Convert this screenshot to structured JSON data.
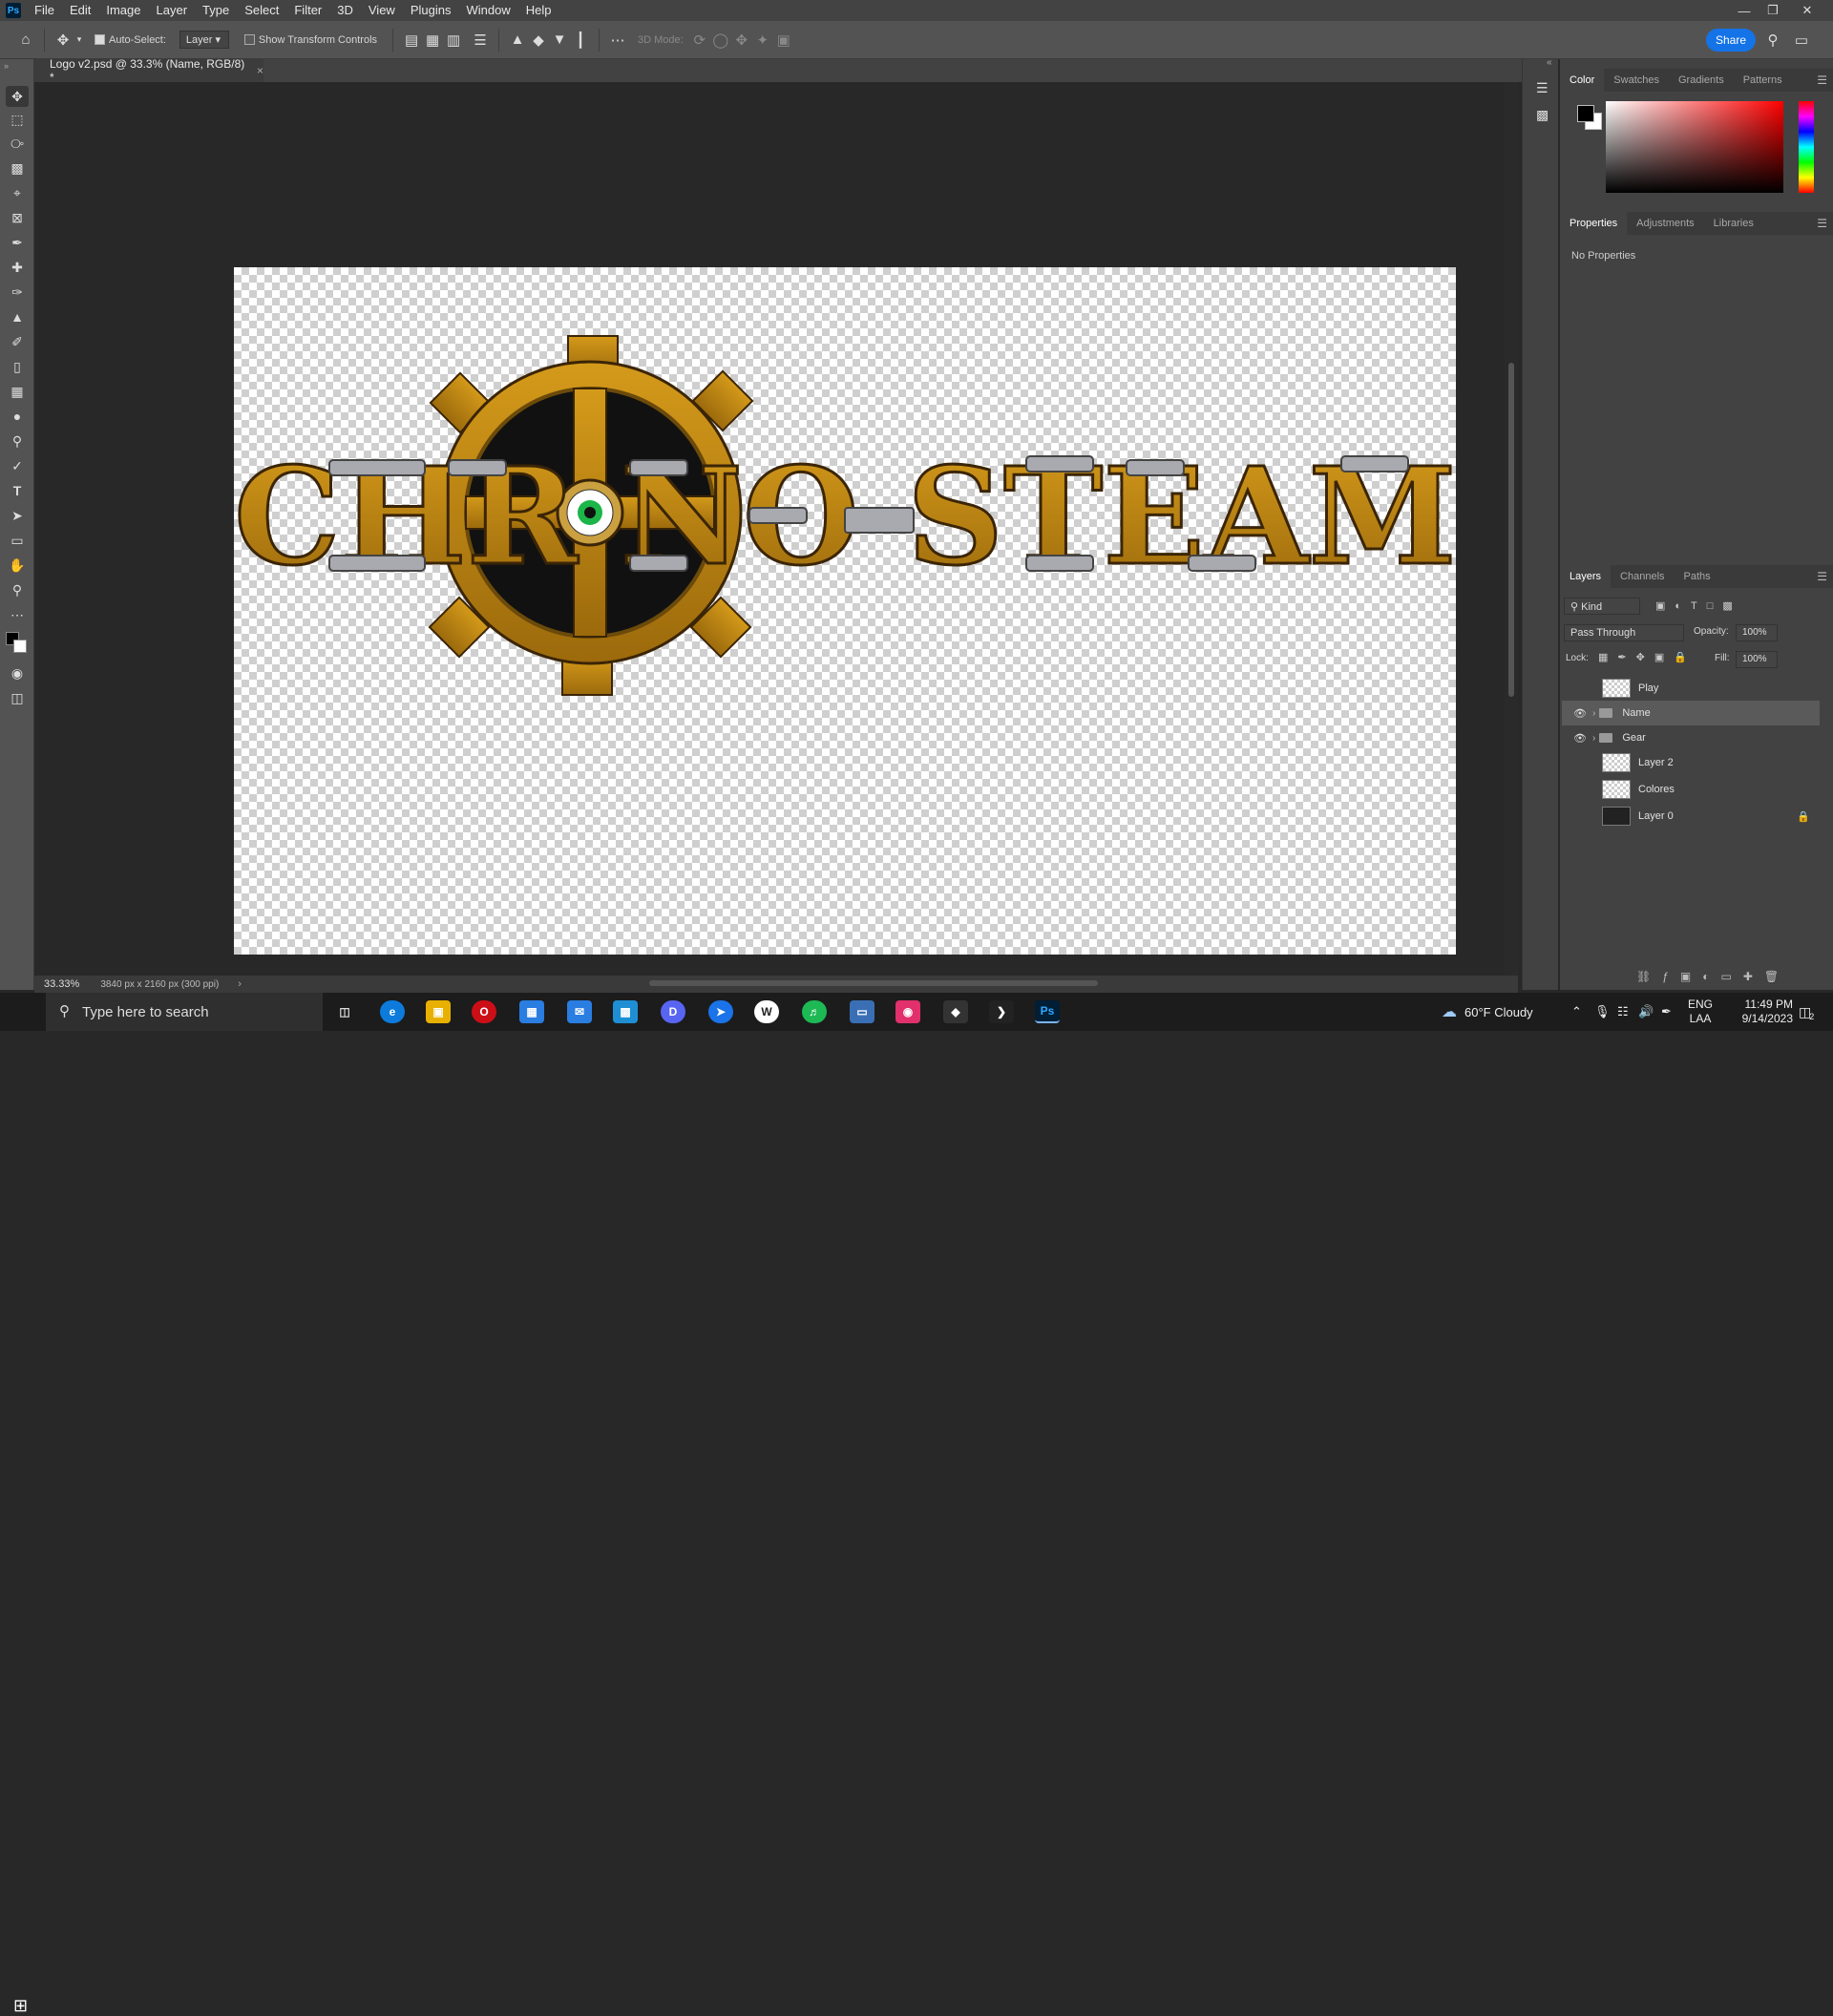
{
  "menubar": {
    "items": [
      "File",
      "Edit",
      "Image",
      "Layer",
      "Type",
      "Select",
      "Filter",
      "3D",
      "View",
      "Plugins",
      "Window",
      "Help"
    ]
  },
  "options_bar": {
    "auto_select_label": "Auto-Select:",
    "auto_select_checked": true,
    "auto_select_target": "Layer",
    "show_transform_label": "Show Transform Controls",
    "mode_3d_label": "3D Mode:",
    "share_label": "Share"
  },
  "document": {
    "tab_title": "Logo v2.psd @ 33.3% (Name, RGB/8) *",
    "artwork": {
      "logo_text_left": "CHR",
      "logo_text_mid": "NO",
      "logo_text_right": "STEAM",
      "brass_color": "#b8860b",
      "dark_color": "#3b2507"
    }
  },
  "status": {
    "zoom": "33.33%",
    "doc_info": "3840 px x 2160 px (300 ppi)"
  },
  "color_panel": {
    "tabs": [
      "Color",
      "Swatches",
      "Gradients",
      "Patterns"
    ],
    "active_tab": "Color",
    "foreground": "#000000",
    "background": "#ffffff",
    "hue": "#ff0000"
  },
  "properties_panel": {
    "tabs": [
      "Properties",
      "Adjustments",
      "Libraries"
    ],
    "active_tab": "Properties",
    "empty_text": "No Properties"
  },
  "layers_panel": {
    "tabs": [
      "Layers",
      "Channels",
      "Paths"
    ],
    "active_tab": "Layers",
    "filter_kind": "Kind",
    "blend_mode": "Pass Through",
    "opacity_label": "Opacity:",
    "opacity": "100%",
    "lock_label": "Lock:",
    "fill_label": "Fill:",
    "fill": "100%",
    "layers": [
      {
        "name": "Play",
        "visible": false,
        "type": "layer",
        "selected": false,
        "locked": false
      },
      {
        "name": "Name",
        "visible": true,
        "type": "group",
        "selected": true,
        "locked": false
      },
      {
        "name": "Gear",
        "visible": true,
        "type": "group",
        "selected": false,
        "locked": false
      },
      {
        "name": "Layer 2",
        "visible": false,
        "type": "layer",
        "selected": false,
        "locked": false
      },
      {
        "name": "Colores",
        "visible": false,
        "type": "layer",
        "selected": false,
        "locked": false
      },
      {
        "name": "Layer 0",
        "visible": false,
        "type": "layer",
        "selected": false,
        "locked": true
      }
    ]
  },
  "taskbar": {
    "search_placeholder": "Type here to search",
    "weather": "60°F  Cloudy",
    "lang": "ENG",
    "region": "LAA",
    "time": "11:49 PM",
    "date": "9/14/2023",
    "notification_count": "2"
  }
}
